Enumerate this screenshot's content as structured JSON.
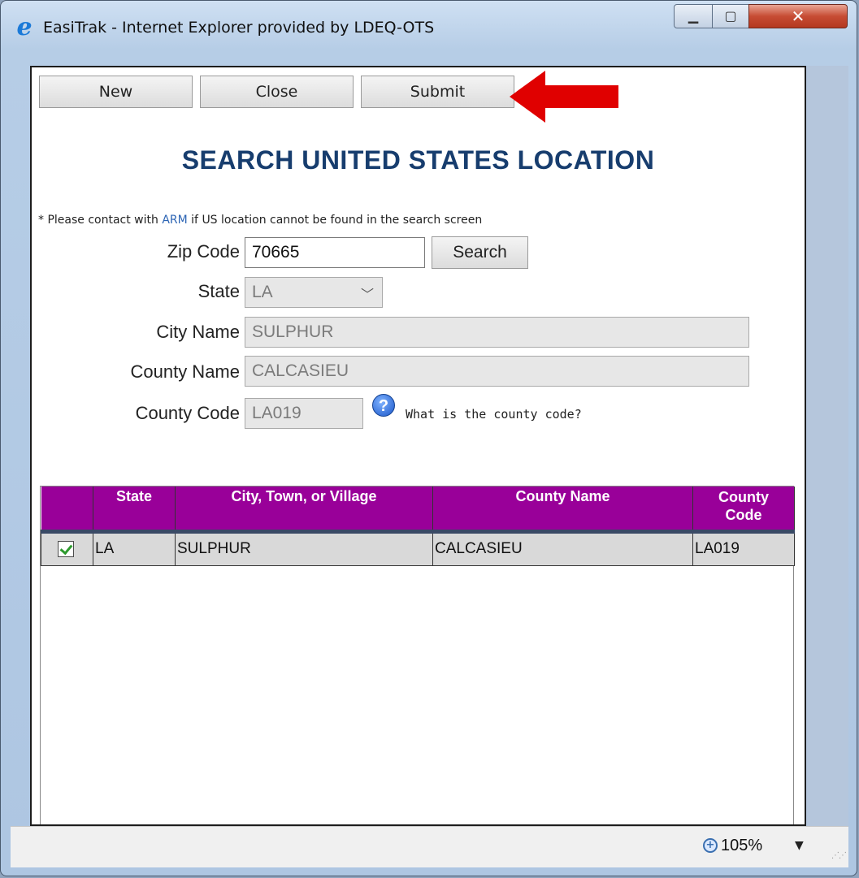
{
  "window": {
    "title": "EasiTrak - Internet Explorer provided by LDEQ-OTS",
    "minimize_icon": "minimize-icon",
    "maximize_icon": "maximize-icon",
    "close_icon": "close-icon"
  },
  "toolbar": {
    "new_label": "New",
    "close_label": "Close",
    "submit_label": "Submit"
  },
  "page": {
    "title": "SEARCH UNITED STATES LOCATION",
    "note_prefix": "* Please contact with ",
    "note_link": "ARM",
    "note_suffix": " if US location cannot be found in the search screen"
  },
  "form": {
    "zip_label": "Zip Code",
    "zip_value": "70665",
    "search_label": "Search",
    "state_label": "State",
    "state_value": "LA",
    "city_label": "City Name",
    "city_value": "SULPHUR",
    "county_name_label": "County Name",
    "county_name_value": "CALCASIEU",
    "county_code_label": "County Code",
    "county_code_value": "LA019",
    "help_text": "What is the county code?",
    "help_icon": "question-icon"
  },
  "grid": {
    "headers": [
      "",
      "State",
      "City, Town, or Village",
      "County Name",
      "County\nCode"
    ],
    "rows": [
      {
        "checked": true,
        "state": "LA",
        "city": "SULPHUR",
        "county_name": "CALCASIEU",
        "county_code": "LA019"
      }
    ]
  },
  "statusbar": {
    "zoom": "105%",
    "zoom_icon": "zoom-in-icon"
  },
  "colors": {
    "grid_header": "#990099",
    "title_color": "#173d6e",
    "annotation_arrow": "#e00000"
  }
}
